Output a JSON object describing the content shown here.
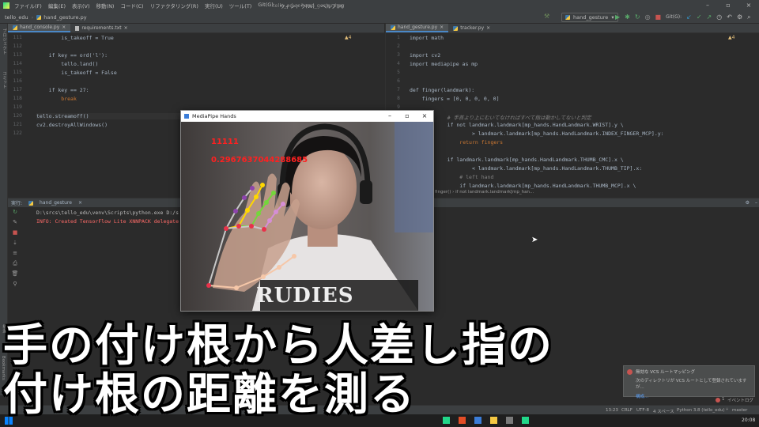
{
  "title_bar": {
    "menu": [
      "ファイル(F)",
      "編集(E)",
      "表示(V)",
      "移動(N)",
      "コード(C)",
      "リファクタリング(R)",
      "実行(U)",
      "ツール(T)",
      "Git(G)",
      "ウィンドウ(W)",
      "ヘルプ(H)"
    ],
    "window_title": "tello_edu - hand_gesture.py"
  },
  "nav_bar": {
    "project": "tello_edu",
    "file": "hand_gesture.py",
    "run_config": "hand_gesture",
    "git_label": "Git(G):"
  },
  "side_labels": [
    "プロジェクト",
    "コミット",
    "構造",
    "Bookmarks"
  ],
  "left_editor": {
    "tabs": [
      "hand_console.py",
      "requirements.txt"
    ],
    "warnings": "4",
    "lines": [
      {
        "n": "111",
        "text": "        is_takeoff = True"
      },
      {
        "n": "112",
        "text": ""
      },
      {
        "n": "113",
        "text": "    if key == ord('l'):"
      },
      {
        "n": "114",
        "text": "        tello.land()"
      },
      {
        "n": "115",
        "text": "        is_takeoff = False"
      },
      {
        "n": "116",
        "text": ""
      },
      {
        "n": "117",
        "text": "    if key == 27:"
      },
      {
        "n": "118",
        "text": "        break"
      },
      {
        "n": "119",
        "text": ""
      },
      {
        "n": "120",
        "text": "tello.streamoff()"
      },
      {
        "n": "121",
        "text": "cv2.destroyAllWindows()"
      },
      {
        "n": "122",
        "text": ""
      }
    ]
  },
  "right_editor": {
    "tabs": [
      "hand_gesture.py",
      "tracker.py"
    ],
    "warnings": "4",
    "lines": [
      {
        "n": "1",
        "text": "import math"
      },
      {
        "n": "2",
        "text": ""
      },
      {
        "n": "3",
        "text": "import cv2"
      },
      {
        "n": "4",
        "text": "import mediapipe as mp"
      },
      {
        "n": "5",
        "text": ""
      },
      {
        "n": "6",
        "text": ""
      },
      {
        "n": "7",
        "text": "def finger(landmark):"
      },
      {
        "n": "8",
        "text": "    fingers = [0, 0, 0, 0, 0]"
      },
      {
        "n": "9",
        "text": ""
      },
      {
        "n": "10",
        "text": "    # 手首より上にむいてなければすべて指は動かしてないと判定"
      },
      {
        "n": "11",
        "text": "    if not landmark.landmark[mp_hands.HandLandmark.WRIST].y \\"
      },
      {
        "n": "12",
        "text": "            > landmark.landmark[mp_hands.HandLandmark.INDEX_FINGER_MCP].y:"
      },
      {
        "n": "13",
        "text": "        return fingers"
      },
      {
        "n": "14",
        "text": ""
      },
      {
        "n": "15",
        "text": "    if landmark.landmark[mp_hands.HandLandmark.THUMB_CMC].x \\"
      },
      {
        "n": "16",
        "text": "            < landmark.landmark[mp_hands.HandLandmark.THUMB_TIP].x:"
      },
      {
        "n": "17",
        "text": "        # left hand"
      },
      {
        "n": "18",
        "text": "        if landmark.landmark[mp_hands.HandLandmark.THUMB_MCP].x \\"
      }
    ],
    "breadcrumb": "finger() › if not landmark.landmark[mp_han..."
  },
  "run_panel": {
    "label": "実行:",
    "tab": "hand_gesture",
    "output": [
      "D:\\srcs\\tello_edu\\venv\\Scripts\\python.exe D:/s",
      "INFO: Created TensorFlow Lite XNNPACK delegate"
    ]
  },
  "mediapipe_window": {
    "title": "MediaPipe Hands",
    "finger_state": "11111",
    "distance_value": "0.2967637044288685",
    "shirt_text": "RUDIES"
  },
  "notification": {
    "title": "無効な VCS ルートマッピング",
    "body": "次のディレクトリが VCS ルートとして登録されていますが...",
    "link": "構成..."
  },
  "status_bar": {
    "position": "13:23",
    "line_sep": "CRLF",
    "encoding": "UTF-8",
    "indent": "4 スペース",
    "interpreter": "Python 3.8 (tello_edu)",
    "branch": "master",
    "event_log": "イベントログ",
    "event_count": "1"
  },
  "taskbar": {
    "time": "20:08"
  },
  "subtitles": [
    "手の付け根から人差し指の",
    "付け根の距離を測る"
  ],
  "colors": {
    "ide_bg": "#2b2b2b",
    "panel_bg": "#3c3f41",
    "keyword": "#cc7832",
    "error_text": "#ff6b68",
    "overlay_text": "#ff2020"
  }
}
